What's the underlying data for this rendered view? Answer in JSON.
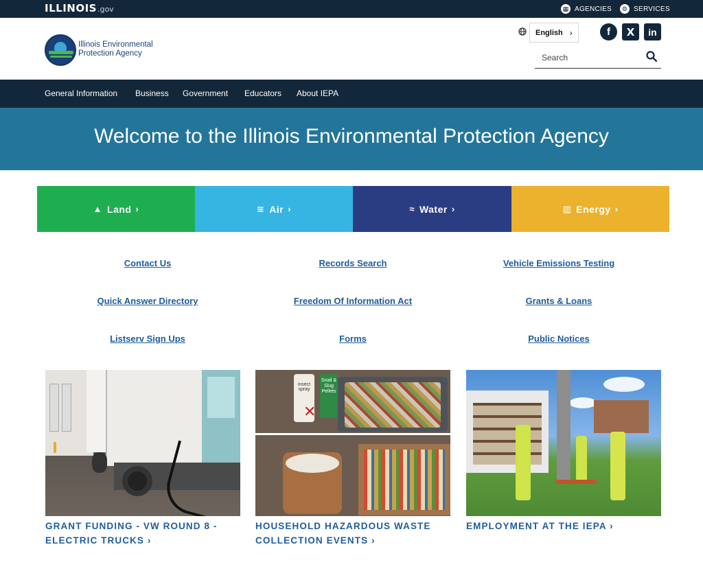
{
  "topbar": {
    "state_logo": "ILLINOIS",
    "state_logo_suffix": ".gov",
    "agencies_label": "AGENCIES",
    "services_label": "SERVICES"
  },
  "header": {
    "agency_name_line1": "Illinois Environmental",
    "agency_name_line2": "Protection Agency",
    "language_label": "English",
    "search_placeholder": "Search"
  },
  "social": {
    "facebook": "f",
    "x": "X",
    "linkedin": "in"
  },
  "nav": {
    "items": [
      "General Information",
      "Business",
      "Government",
      "Educators",
      "About IEPA"
    ]
  },
  "hero": {
    "title": "Welcome to the Illinois Environmental Protection Agency"
  },
  "tiles": [
    {
      "label": "Land",
      "icon": "tree-icon",
      "color": "#1fae4f"
    },
    {
      "label": "Air",
      "icon": "wind-icon",
      "color": "#36b5e3"
    },
    {
      "label": "Water",
      "icon": "waves-icon",
      "color": "#2b3d82"
    },
    {
      "label": "Energy",
      "icon": "factory-icon",
      "color": "#ecb22e"
    }
  ],
  "quick_links": [
    [
      "Contact Us",
      "Records Search",
      "Vehicle Emissions Testing"
    ],
    [
      "Quick Answer Directory",
      "Freedom Of Information Act",
      "Grants & Loans"
    ],
    [
      "Listserv Sign Ups",
      "Forms",
      "Public Notices"
    ]
  ],
  "cards": [
    {
      "line1": "GRANT FUNDING - VW ROUND 8 -",
      "line2": "ELECTRIC TRUCKS"
    },
    {
      "line1": "HOUSEHOLD HAZARDOUS WASTE",
      "line2": "COLLECTION EVENTS"
    },
    {
      "line1": "EMPLOYMENT AT THE IEPA",
      "line2": ""
    }
  ],
  "photo_text": {
    "insect_spray": "insect spray",
    "slug_pellets": "Snail & Slug Pellets"
  },
  "colors": {
    "topbar": "#13273a",
    "hero": "#23759a",
    "link": "#1f5c9e"
  }
}
